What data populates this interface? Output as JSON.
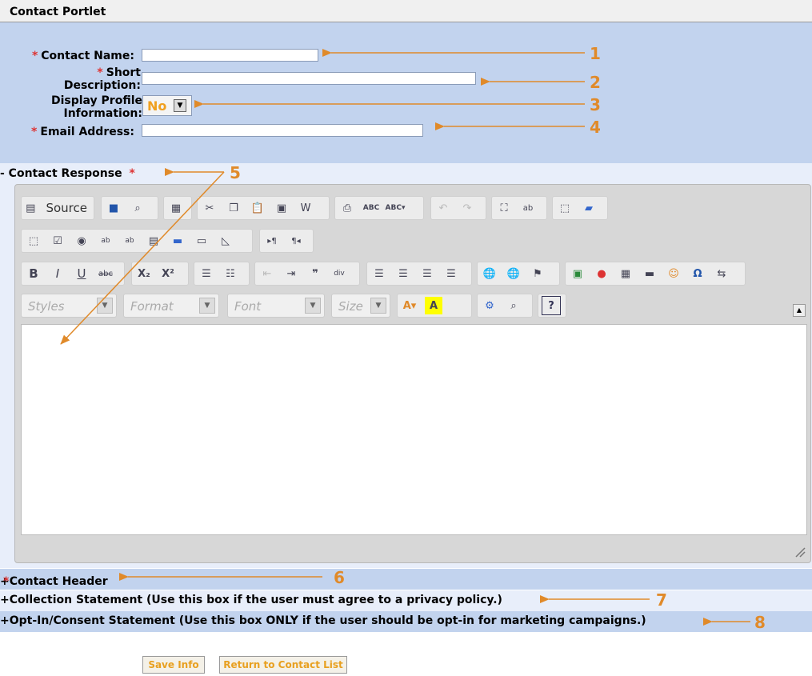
{
  "window": {
    "title": "Contact Portlet"
  },
  "form": {
    "contact_name_label": "Contact Name:",
    "short_desc_label_1": "Short",
    "short_desc_label_2": "Description:",
    "display_profile_label_1": "Display Profile",
    "display_profile_label_2": "Information:",
    "display_profile_value": "No",
    "email_label": "Email Address:",
    "required_mark": "*"
  },
  "sections": {
    "contact_response": "- Contact Response",
    "contact_header": "+Contact Header",
    "collection_statement": "+Collection Statement (Use this box if the user must agree to a privacy policy.)",
    "optin_statement": "+Opt-In/Consent Statement (Use this box ONLY if the user should be opt-in for marketing campaigns.)"
  },
  "editor": {
    "source_label": "Source",
    "styles_placeholder": "Styles",
    "format_placeholder": "Format",
    "font_placeholder": "Font",
    "size_placeholder": "Size"
  },
  "buttons": {
    "save": "Save Info",
    "return": "Return to Contact List"
  },
  "annotations": [
    "1",
    "2",
    "3",
    "4",
    "5",
    "6",
    "7",
    "8"
  ],
  "colors": {
    "form_bg": "#c2d3ee",
    "band_dark": "#c2d3ee",
    "band_light": "#e8eefa",
    "annotation": "#e08a2a",
    "required": "#d33333"
  }
}
